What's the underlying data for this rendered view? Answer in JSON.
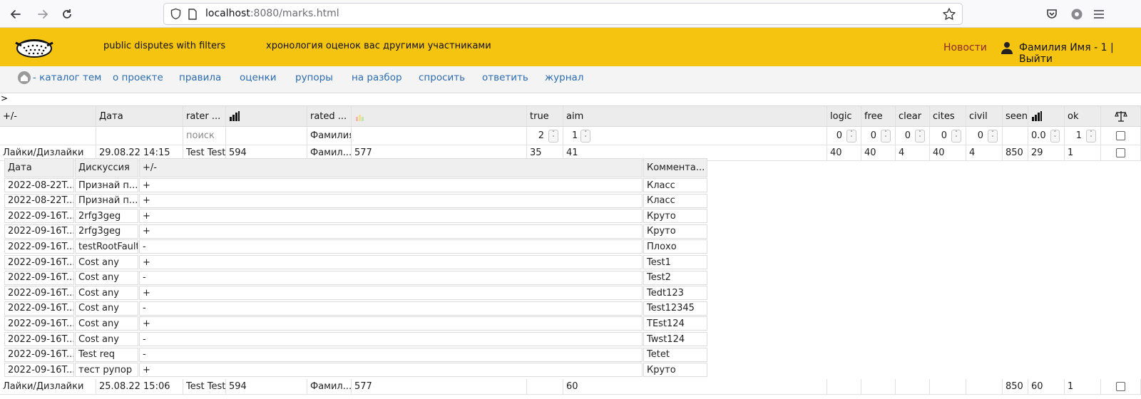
{
  "browser": {
    "url_host": "localhost",
    "url_rest": ":8080/marks.html"
  },
  "header": {
    "link_disputes": "public disputes with filters",
    "link_chronology": "хронология оценок вас другими участниками",
    "news": "Новости",
    "user": "Фамилия Имя - 1 | Выйти"
  },
  "nav": {
    "catalog": "- каталог тем",
    "about": "о проекте",
    "rules": "правила",
    "ratings": "оценки",
    "megaphones": "рупоры",
    "review": "на разбор",
    "ask": "спросить",
    "answer": "ответить",
    "journal": "журнал"
  },
  "breadcrumb": ">",
  "grid": {
    "headers": {
      "plusminus": "+/-",
      "date": "Дата",
      "rater": "rater ...",
      "rated": "rated ...",
      "true": "true",
      "aim": "aim",
      "logic": "logic",
      "free": "free",
      "clear": "clear",
      "cites": "cites",
      "civil": "civil",
      "seen": "seen",
      "ok": "ok"
    },
    "filters": {
      "rater_placeholder": "поиск",
      "rated_value": "Фамилия",
      "true": "2",
      "aim": "1",
      "logic": "0",
      "free": "0",
      "clear": "0",
      "cites": "0",
      "civil": "0",
      "seen_bar": "0.0",
      "ok": "1"
    },
    "rows": [
      {
        "type": "Лайки/Дизлайки",
        "date": "29.08.22 14:15",
        "rater": "Test Test",
        "rater_score": "594",
        "rated": "Фамил...",
        "rated_score": "577",
        "true": "35",
        "aim": "41",
        "logic": "40",
        "free": "40",
        "clear": "4",
        "cites": "40",
        "civil": "4",
        "seen": "850",
        "seen_bar": "29",
        "ok": "1"
      },
      {
        "type": "Лайки/Дизлайки",
        "date": "25.08.22 15:06",
        "rater": "Test Test",
        "rater_score": "594",
        "rated": "Фамил...",
        "rated_score": "577",
        "true": "",
        "aim": "60",
        "logic": "",
        "free": "",
        "clear": "",
        "cites": "",
        "civil": "",
        "seen": "850",
        "seen_bar": "60",
        "ok": "1"
      }
    ]
  },
  "detail": {
    "headers": {
      "date": "Дата",
      "discussion": "Дискуссия",
      "plusminus": "+/-",
      "comment": "Коммента..."
    },
    "rows": [
      {
        "date": "2022-08-22T...",
        "discussion": "Признай п...",
        "pm": "+",
        "comment": "Класс"
      },
      {
        "date": "2022-08-22T...",
        "discussion": "Признай п...",
        "pm": "+",
        "comment": "Класс"
      },
      {
        "date": "2022-09-16T...",
        "discussion": "2rfg3geg",
        "pm": "+",
        "comment": "Круто"
      },
      {
        "date": "2022-09-16T...",
        "discussion": "2rfg3geg",
        "pm": "+",
        "comment": "Круто"
      },
      {
        "date": "2022-09-16T...",
        "discussion": "testRootFault",
        "pm": "-",
        "comment": "Плохо"
      },
      {
        "date": "2022-09-16T...",
        "discussion": "Cost any",
        "pm": "+",
        "comment": "Test1"
      },
      {
        "date": "2022-09-16T...",
        "discussion": "Cost any",
        "pm": "-",
        "comment": "Test2"
      },
      {
        "date": "2022-09-16T...",
        "discussion": "Cost any",
        "pm": "+",
        "comment": "Tedt123"
      },
      {
        "date": "2022-09-16T...",
        "discussion": "Cost any",
        "pm": "-",
        "comment": "Test12345"
      },
      {
        "date": "2022-09-16T...",
        "discussion": "Cost any",
        "pm": "+",
        "comment": "TEst124"
      },
      {
        "date": "2022-09-16T...",
        "discussion": "Cost any",
        "pm": "-",
        "comment": "Twst124"
      },
      {
        "date": "2022-09-16T...",
        "discussion": "Test req",
        "pm": "-",
        "comment": "Tetet"
      },
      {
        "date": "2022-09-16T...",
        "discussion": "тест рупор",
        "pm": "+",
        "comment": "Круто"
      }
    ]
  },
  "icons": {
    "back": "arrow-left-icon",
    "forward": "arrow-right-icon",
    "reload": "reload-icon",
    "shield": "shield-icon",
    "bookmark": "star-icon",
    "pocket": "pocket-icon",
    "extensions": "gear-icon",
    "menu": "hamburger-icon",
    "logo": "colander-logo",
    "user": "user-icon",
    "home": "home-icon",
    "bars": "bar-chart-icon",
    "balance": "scales-icon"
  },
  "colors": {
    "header_bg": "#f5c411",
    "nav_link": "#2a6cb5",
    "news_link": "#8b2a1f"
  }
}
